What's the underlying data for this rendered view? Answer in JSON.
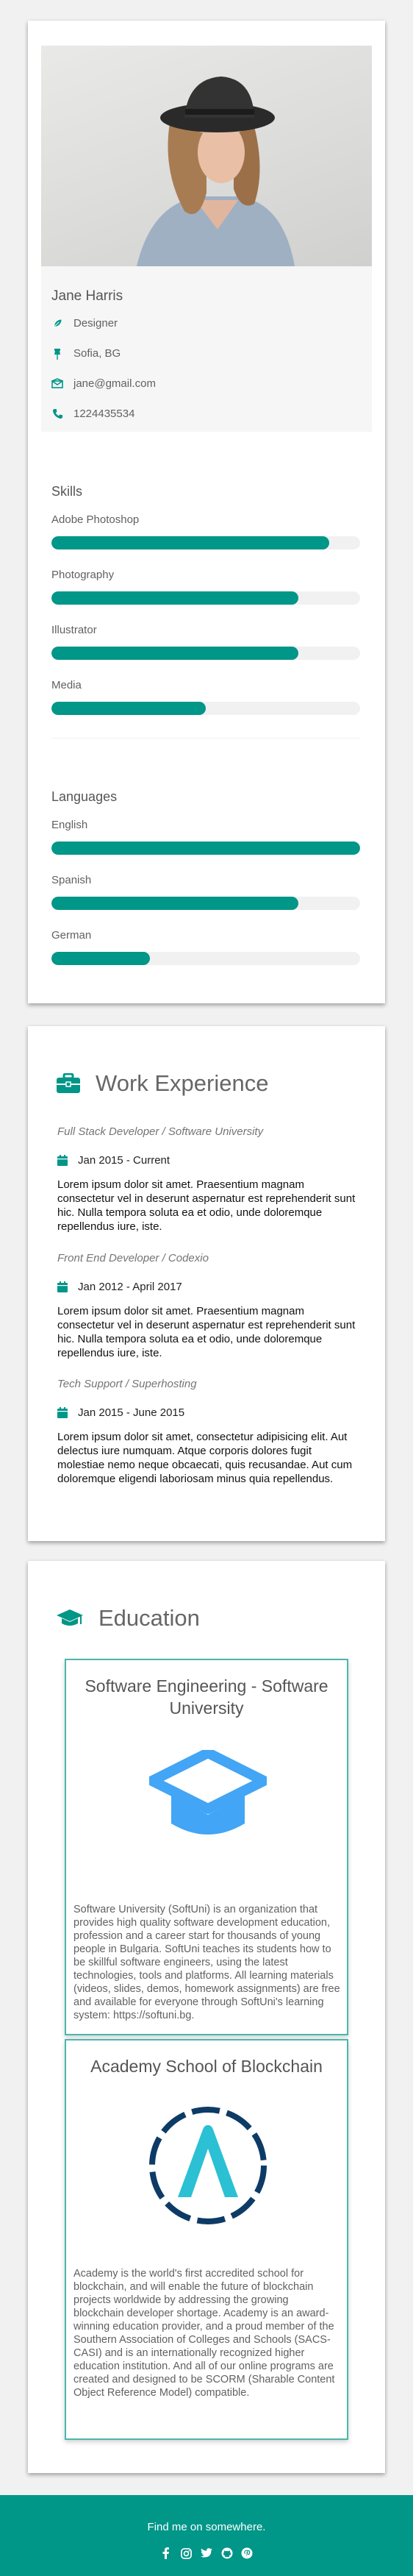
{
  "colors": {
    "accent": "#009688",
    "card_bg": "#ffffff",
    "page_bg": "#f1f1f1",
    "edu_border": "#4db6ac",
    "logo_blue": "#42a5f5"
  },
  "profile": {
    "name": "Jane Harris",
    "job": {
      "icon": "feather-icon",
      "text": "Designer"
    },
    "location": {
      "icon": "map-pin-icon",
      "text": "Sofia, BG"
    },
    "email": {
      "icon": "envelope-icon",
      "text": "jane@gmail.com"
    },
    "phone": {
      "icon": "phone-icon",
      "text": "1224435534"
    }
  },
  "skills": {
    "title": "Skills",
    "items": [
      {
        "label": "Adobe Photoshop",
        "level": 0.9
      },
      {
        "label": "Photography",
        "level": 0.8
      },
      {
        "label": "Illustrator",
        "level": 0.8
      },
      {
        "label": "Media",
        "level": 0.5
      }
    ]
  },
  "languages": {
    "title": "Languages",
    "items": [
      {
        "label": "English",
        "level": 1.0
      },
      {
        "label": "Spanish",
        "level": 0.8
      },
      {
        "label": "German",
        "level": 0.32
      }
    ]
  },
  "work": {
    "title": "Work Experience",
    "icon": "briefcase-icon",
    "jobs": [
      {
        "title": "Full Stack Developer / Software University",
        "date": "Jan 2015 - Current",
        "description": "Lorem ipsum dolor sit amet. Praesentium magnam consectetur vel in deserunt aspernatur est reprehenderit sunt hic. Nulla tempora soluta ea et odio, unde doloremque repellendus iure, iste."
      },
      {
        "title": "Front End Developer / Codexio",
        "date": "Jan 2012 - April 2017",
        "description": "Lorem ipsum dolor sit amet. Praesentium magnam consectetur vel in deserunt aspernatur est reprehenderit sunt hic. Nulla tempora soluta ea et odio, unde doloremque repellendus iure, iste."
      },
      {
        "title": "Tech Support / Superhosting",
        "date": "Jan 2015 - June 2015",
        "description": "Lorem ipsum dolor sit amet, consectetur adipisicing elit. Aut delectus iure numquam. Atque corporis dolores fugit molestiae nemo neque obcaecati, quis recusandae. Aut cum doloremque eligendi laboriosam minus quia repellendus."
      }
    ]
  },
  "education": {
    "title": "Education",
    "icon": "graduation-cap-icon",
    "items": [
      {
        "name": "Software Engineering - Software University",
        "logo": "graduation-cap-logo",
        "description": "Software University (SoftUni) is an organization that provides high quality software development education, profession and a career start for thousands of young people in Bulgaria. SoftUni teaches its students how to be skillful software engineers, using the latest technologies, tools and platforms. All learning materials (videos, slides, demos, homework assignments) are free and available for everyone through SoftUni's learning system: https://softuni.bg."
      },
      {
        "name": "Academy School of Blockchain",
        "logo": "blockchain-academy-logo",
        "description": "Academy is the world's first accredited school for blockchain, and will enable the future of blockchain projects worldwide by addressing the growing blockchain developer shortage. Academy is an award-winning education provider, and a proud member of the Southern Association of Colleges and Schools (SACS-CASI) and is an internationally recognized higher education institution. And all of our online programs are created and designed to be SCORM (Sharable Content Object Reference Model) compatible."
      }
    ]
  },
  "footer": {
    "text": "Find me on somewhere.",
    "social": [
      {
        "icon": "facebook-icon",
        "glyph": "f"
      },
      {
        "icon": "instagram-icon",
        "glyph": "◎"
      },
      {
        "icon": "twitter-icon",
        "glyph": "✦"
      },
      {
        "icon": "github-icon",
        "glyph": "●"
      },
      {
        "icon": "pinterest-icon",
        "glyph": "℗"
      }
    ]
  }
}
